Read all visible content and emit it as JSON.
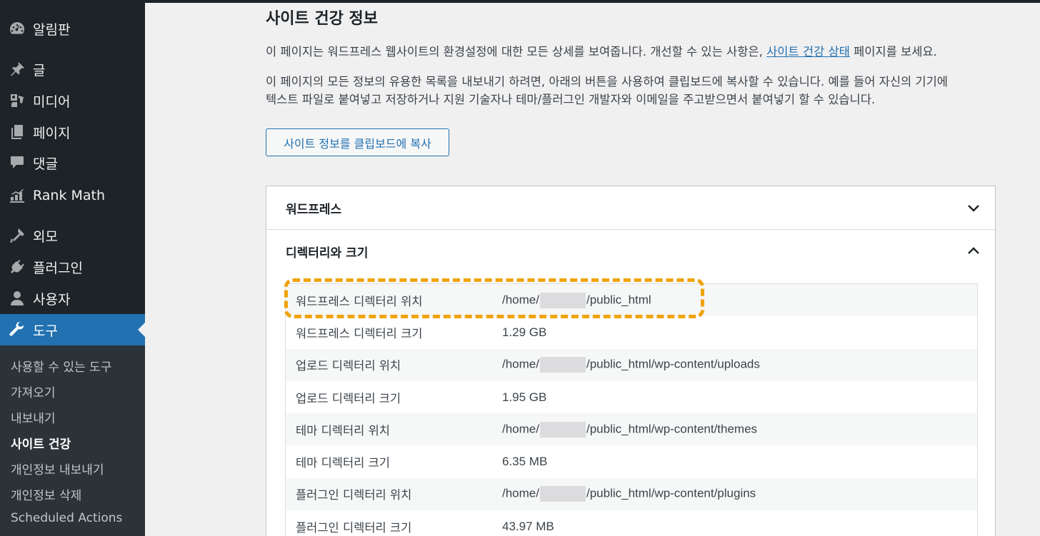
{
  "sidebar": {
    "items": [
      {
        "label": "알림판",
        "icon": "dashboard-icon"
      },
      {
        "label": "글",
        "icon": "pin-icon"
      },
      {
        "label": "미디어",
        "icon": "media-icon"
      },
      {
        "label": "페이지",
        "icon": "pages-icon"
      },
      {
        "label": "댓글",
        "icon": "comments-icon"
      },
      {
        "label": "Rank Math",
        "icon": "rank-math-icon"
      },
      {
        "label": "외모",
        "icon": "appearance-icon"
      },
      {
        "label": "플러그인",
        "icon": "plugins-icon"
      },
      {
        "label": "사용자",
        "icon": "users-icon"
      },
      {
        "label": "도구",
        "icon": "tools-icon"
      }
    ],
    "submenu": [
      "사용할 수 있는 도구",
      "가져오기",
      "내보내기",
      "사이트 건강",
      "개인정보 내보내기",
      "개인정보 삭제",
      "Scheduled Actions"
    ]
  },
  "main": {
    "title": "사이트 건강 정보",
    "intro_before_link": "이 페이지는 워드프레스 웹사이트의 환경설정에 대한 모든 상세를 보여줍니다. 개선할 수 있는 사항은, ",
    "intro_link": "사이트 건강 상태",
    "intro_after_link": " 페이지를 보세요.",
    "export_line1": "이 페이지의 모든 정보의 유용한 목록을 내보내기 하려면, 아래의 버튼을 사용하여 클립보드에 복사할 수 있습니다. 예를 들어 자신의 기기에",
    "export_line2": "텍스트 파일로 붙여넣고 저장하거나 지원 기술자나 테마/플러그인 개발자와 이메일을 주고받으면서 붙여넣기 할 수 있습니다.",
    "copy_button": "사이트 정보를 클립보드에 복사",
    "sections": [
      {
        "label": "워드프레스",
        "state": "collapsed"
      },
      {
        "label": "디렉터리와 크기",
        "state": "expanded"
      }
    ],
    "rows": [
      {
        "key": "워드프레스 디렉터리 위치",
        "pre": "/home/",
        "redacted": true,
        "post": "/public_html"
      },
      {
        "key": "워드프레스 디렉터리 크기",
        "pre": "1.29 GB",
        "redacted": false,
        "post": ""
      },
      {
        "key": "업로드 디렉터리 위치",
        "pre": "/home/",
        "redacted": true,
        "post": "/public_html/wp-content/uploads"
      },
      {
        "key": "업로드 디렉터리 크기",
        "pre": "1.95 GB",
        "redacted": false,
        "post": ""
      },
      {
        "key": "테마 디렉터리 위치",
        "pre": "/home/",
        "redacted": true,
        "post": "/public_html/wp-content/themes"
      },
      {
        "key": "테마 디렉터리 크기",
        "pre": "6.35 MB",
        "redacted": false,
        "post": ""
      },
      {
        "key": "플러그인 디렉터리 위치",
        "pre": "/home/",
        "redacted": true,
        "post": "/public_html/wp-content/plugins"
      },
      {
        "key": "플러그인 디렉터리 크기",
        "pre": "43.97 MB",
        "redacted": false,
        "post": ""
      }
    ]
  },
  "colors": {
    "sidebar_bg": "#1d2327",
    "accent": "#2271b1",
    "highlight": "#f0a30a"
  }
}
